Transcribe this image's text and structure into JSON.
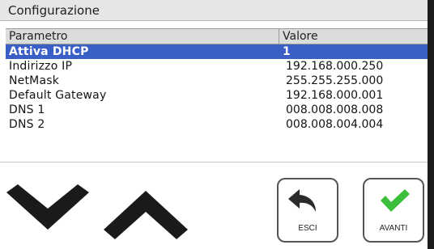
{
  "window": {
    "title": "Configurazione"
  },
  "table": {
    "headers": {
      "param": "Parametro",
      "value": "Valore"
    },
    "rows": [
      {
        "name": "Attiva DHCP",
        "value": "1",
        "selected": true
      },
      {
        "name": "Indirizzo IP",
        "value": "192.168.000.250"
      },
      {
        "name": "NetMask",
        "value": "255.255.255.000"
      },
      {
        "name": "Default Gateway",
        "value": "192.168.000.001"
      },
      {
        "name": "DNS 1",
        "value": "008.008.008.008"
      },
      {
        "name": "DNS 2",
        "value": "008.008.004.004"
      }
    ]
  },
  "controls": {
    "scroll_down_icon": "chevron-down-icon",
    "scroll_up_icon": "chevron-up-icon",
    "esci_label": "ESCI",
    "esci_icon": "back-arrow-icon",
    "avanti_label": "AVANTI",
    "avanti_icon": "checkmark-icon"
  },
  "colors": {
    "selection": "#3a5fc6",
    "check_green": "#3cbf3c",
    "arrow_dark": "#1a1a1a"
  }
}
